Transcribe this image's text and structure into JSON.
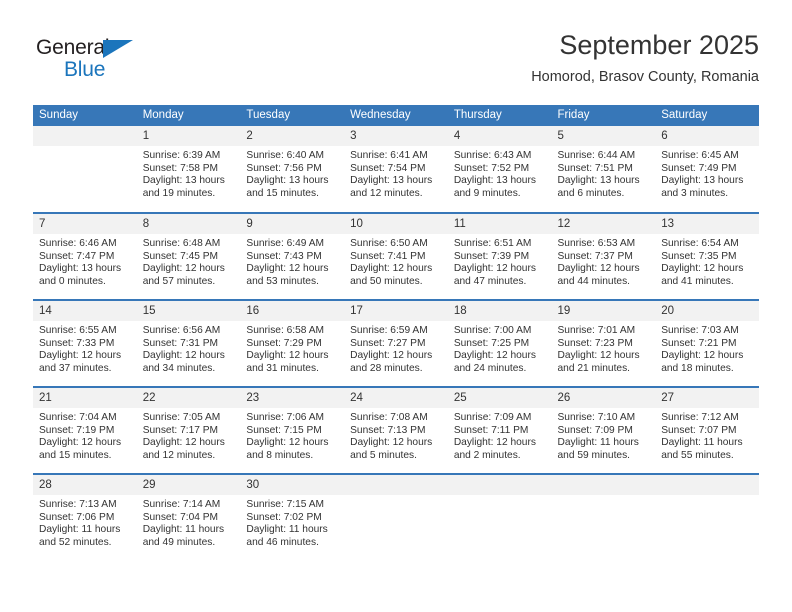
{
  "brand": {
    "name_part1": "General",
    "name_part2": "Blue",
    "triangle_icon": "brand-triangle-icon",
    "color_primary": "#1b75bc",
    "color_text": "#231f20"
  },
  "header": {
    "title": "September 2025",
    "subtitle": "Homorod, Brasov County, Romania"
  },
  "theme": {
    "header_bar": "#3777b8",
    "daynum_band": "#f2f2f2",
    "row_separator": "#3777b8",
    "text": "#333333"
  },
  "weekdays": [
    "Sunday",
    "Monday",
    "Tuesday",
    "Wednesday",
    "Thursday",
    "Friday",
    "Saturday"
  ],
  "weeks": [
    [
      {
        "day": "",
        "sunrise": "",
        "sunset": "",
        "daylight_line1": "",
        "daylight_line2": "",
        "blank": true
      },
      {
        "day": "1",
        "sunrise": "Sunrise: 6:39 AM",
        "sunset": "Sunset: 7:58 PM",
        "daylight_line1": "Daylight: 13 hours",
        "daylight_line2": "and 19 minutes."
      },
      {
        "day": "2",
        "sunrise": "Sunrise: 6:40 AM",
        "sunset": "Sunset: 7:56 PM",
        "daylight_line1": "Daylight: 13 hours",
        "daylight_line2": "and 15 minutes."
      },
      {
        "day": "3",
        "sunrise": "Sunrise: 6:41 AM",
        "sunset": "Sunset: 7:54 PM",
        "daylight_line1": "Daylight: 13 hours",
        "daylight_line2": "and 12 minutes."
      },
      {
        "day": "4",
        "sunrise": "Sunrise: 6:43 AM",
        "sunset": "Sunset: 7:52 PM",
        "daylight_line1": "Daylight: 13 hours",
        "daylight_line2": "and 9 minutes."
      },
      {
        "day": "5",
        "sunrise": "Sunrise: 6:44 AM",
        "sunset": "Sunset: 7:51 PM",
        "daylight_line1": "Daylight: 13 hours",
        "daylight_line2": "and 6 minutes."
      },
      {
        "day": "6",
        "sunrise": "Sunrise: 6:45 AM",
        "sunset": "Sunset: 7:49 PM",
        "daylight_line1": "Daylight: 13 hours",
        "daylight_line2": "and 3 minutes."
      }
    ],
    [
      {
        "day": "7",
        "sunrise": "Sunrise: 6:46 AM",
        "sunset": "Sunset: 7:47 PM",
        "daylight_line1": "Daylight: 13 hours",
        "daylight_line2": "and 0 minutes."
      },
      {
        "day": "8",
        "sunrise": "Sunrise: 6:48 AM",
        "sunset": "Sunset: 7:45 PM",
        "daylight_line1": "Daylight: 12 hours",
        "daylight_line2": "and 57 minutes."
      },
      {
        "day": "9",
        "sunrise": "Sunrise: 6:49 AM",
        "sunset": "Sunset: 7:43 PM",
        "daylight_line1": "Daylight: 12 hours",
        "daylight_line2": "and 53 minutes."
      },
      {
        "day": "10",
        "sunrise": "Sunrise: 6:50 AM",
        "sunset": "Sunset: 7:41 PM",
        "daylight_line1": "Daylight: 12 hours",
        "daylight_line2": "and 50 minutes."
      },
      {
        "day": "11",
        "sunrise": "Sunrise: 6:51 AM",
        "sunset": "Sunset: 7:39 PM",
        "daylight_line1": "Daylight: 12 hours",
        "daylight_line2": "and 47 minutes."
      },
      {
        "day": "12",
        "sunrise": "Sunrise: 6:53 AM",
        "sunset": "Sunset: 7:37 PM",
        "daylight_line1": "Daylight: 12 hours",
        "daylight_line2": "and 44 minutes."
      },
      {
        "day": "13",
        "sunrise": "Sunrise: 6:54 AM",
        "sunset": "Sunset: 7:35 PM",
        "daylight_line1": "Daylight: 12 hours",
        "daylight_line2": "and 41 minutes."
      }
    ],
    [
      {
        "day": "14",
        "sunrise": "Sunrise: 6:55 AM",
        "sunset": "Sunset: 7:33 PM",
        "daylight_line1": "Daylight: 12 hours",
        "daylight_line2": "and 37 minutes."
      },
      {
        "day": "15",
        "sunrise": "Sunrise: 6:56 AM",
        "sunset": "Sunset: 7:31 PM",
        "daylight_line1": "Daylight: 12 hours",
        "daylight_line2": "and 34 minutes."
      },
      {
        "day": "16",
        "sunrise": "Sunrise: 6:58 AM",
        "sunset": "Sunset: 7:29 PM",
        "daylight_line1": "Daylight: 12 hours",
        "daylight_line2": "and 31 minutes."
      },
      {
        "day": "17",
        "sunrise": "Sunrise: 6:59 AM",
        "sunset": "Sunset: 7:27 PM",
        "daylight_line1": "Daylight: 12 hours",
        "daylight_line2": "and 28 minutes."
      },
      {
        "day": "18",
        "sunrise": "Sunrise: 7:00 AM",
        "sunset": "Sunset: 7:25 PM",
        "daylight_line1": "Daylight: 12 hours",
        "daylight_line2": "and 24 minutes."
      },
      {
        "day": "19",
        "sunrise": "Sunrise: 7:01 AM",
        "sunset": "Sunset: 7:23 PM",
        "daylight_line1": "Daylight: 12 hours",
        "daylight_line2": "and 21 minutes."
      },
      {
        "day": "20",
        "sunrise": "Sunrise: 7:03 AM",
        "sunset": "Sunset: 7:21 PM",
        "daylight_line1": "Daylight: 12 hours",
        "daylight_line2": "and 18 minutes."
      }
    ],
    [
      {
        "day": "21",
        "sunrise": "Sunrise: 7:04 AM",
        "sunset": "Sunset: 7:19 PM",
        "daylight_line1": "Daylight: 12 hours",
        "daylight_line2": "and 15 minutes."
      },
      {
        "day": "22",
        "sunrise": "Sunrise: 7:05 AM",
        "sunset": "Sunset: 7:17 PM",
        "daylight_line1": "Daylight: 12 hours",
        "daylight_line2": "and 12 minutes."
      },
      {
        "day": "23",
        "sunrise": "Sunrise: 7:06 AM",
        "sunset": "Sunset: 7:15 PM",
        "daylight_line1": "Daylight: 12 hours",
        "daylight_line2": "and 8 minutes."
      },
      {
        "day": "24",
        "sunrise": "Sunrise: 7:08 AM",
        "sunset": "Sunset: 7:13 PM",
        "daylight_line1": "Daylight: 12 hours",
        "daylight_line2": "and 5 minutes."
      },
      {
        "day": "25",
        "sunrise": "Sunrise: 7:09 AM",
        "sunset": "Sunset: 7:11 PM",
        "daylight_line1": "Daylight: 12 hours",
        "daylight_line2": "and 2 minutes."
      },
      {
        "day": "26",
        "sunrise": "Sunrise: 7:10 AM",
        "sunset": "Sunset: 7:09 PM",
        "daylight_line1": "Daylight: 11 hours",
        "daylight_line2": "and 59 minutes."
      },
      {
        "day": "27",
        "sunrise": "Sunrise: 7:12 AM",
        "sunset": "Sunset: 7:07 PM",
        "daylight_line1": "Daylight: 11 hours",
        "daylight_line2": "and 55 minutes."
      }
    ],
    [
      {
        "day": "28",
        "sunrise": "Sunrise: 7:13 AM",
        "sunset": "Sunset: 7:06 PM",
        "daylight_line1": "Daylight: 11 hours",
        "daylight_line2": "and 52 minutes."
      },
      {
        "day": "29",
        "sunrise": "Sunrise: 7:14 AM",
        "sunset": "Sunset: 7:04 PM",
        "daylight_line1": "Daylight: 11 hours",
        "daylight_line2": "and 49 minutes."
      },
      {
        "day": "30",
        "sunrise": "Sunrise: 7:15 AM",
        "sunset": "Sunset: 7:02 PM",
        "daylight_line1": "Daylight: 11 hours",
        "daylight_line2": "and 46 minutes."
      },
      {
        "day": "",
        "sunrise": "",
        "sunset": "",
        "daylight_line1": "",
        "daylight_line2": "",
        "blank": true
      },
      {
        "day": "",
        "sunrise": "",
        "sunset": "",
        "daylight_line1": "",
        "daylight_line2": "",
        "blank": true
      },
      {
        "day": "",
        "sunrise": "",
        "sunset": "",
        "daylight_line1": "",
        "daylight_line2": "",
        "blank": true
      },
      {
        "day": "",
        "sunrise": "",
        "sunset": "",
        "daylight_line1": "",
        "daylight_line2": "",
        "blank": true
      }
    ]
  ]
}
